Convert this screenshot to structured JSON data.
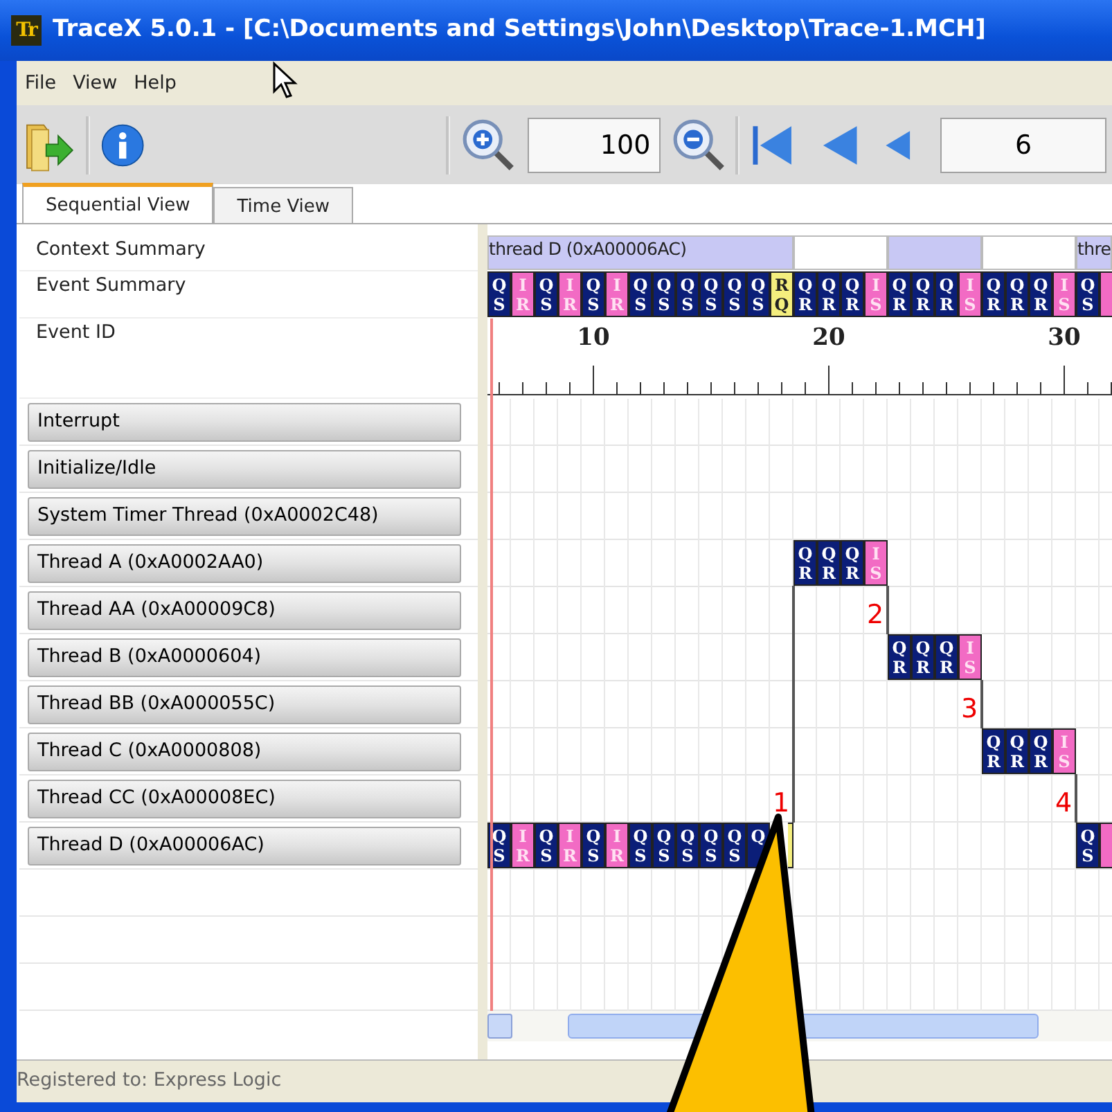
{
  "window": {
    "logo": "Tr",
    "title": "TraceX 5.0.1 - [C:\\Documents and Settings\\John\\Desktop\\Trace-1.MCH]"
  },
  "menu": [
    "File",
    "View",
    "Help"
  ],
  "toolbar": {
    "zoom_value": "100",
    "event_value": "6"
  },
  "tabs": [
    {
      "label": "Sequential View",
      "selected": true
    },
    {
      "label": "Time View",
      "selected": false
    }
  ],
  "summary_labels": [
    "Context Summary",
    "Event Summary",
    "Event ID"
  ],
  "context_segments": [
    {
      "label": "thread D (0xA00006AC)",
      "color": "#c8c8f4"
    },
    {
      "color": "#ffffff"
    },
    {
      "color": "#c8c8f4"
    },
    {
      "color": "#ffffff"
    },
    {
      "label": "thre",
      "color": "#c8c8f4"
    }
  ],
  "event_summary": [
    {
      "top": "Q",
      "bottom": "S",
      "color": "#0b1e78"
    },
    {
      "top": "I",
      "bottom": "R",
      "color": "#f26bc4"
    },
    {
      "top": "Q",
      "bottom": "S",
      "color": "#0b1e78"
    },
    {
      "top": "I",
      "bottom": "R",
      "color": "#f26bc4"
    },
    {
      "top": "Q",
      "bottom": "S",
      "color": "#0b1e78"
    },
    {
      "top": "I",
      "bottom": "R",
      "color": "#f26bc4"
    },
    {
      "top": "Q",
      "bottom": "S",
      "color": "#0b1e78"
    },
    {
      "top": "Q",
      "bottom": "S",
      "color": "#0b1e78"
    },
    {
      "top": "Q",
      "bottom": "S",
      "color": "#0b1e78"
    },
    {
      "top": "Q",
      "bottom": "S",
      "color": "#0b1e78"
    },
    {
      "top": "Q",
      "bottom": "S",
      "color": "#0b1e78"
    },
    {
      "top": "Q",
      "bottom": "S",
      "color": "#0b1e78"
    },
    {
      "top": "R",
      "bottom": "Q",
      "color": "#f4ee7e"
    },
    {
      "top": "Q",
      "bottom": "R",
      "color": "#0b1e78"
    },
    {
      "top": "Q",
      "bottom": "R",
      "color": "#0b1e78"
    },
    {
      "top": "Q",
      "bottom": "R",
      "color": "#0b1e78"
    },
    {
      "top": "I",
      "bottom": "S",
      "color": "#f26bc4"
    },
    {
      "top": "Q",
      "bottom": "R",
      "color": "#0b1e78"
    },
    {
      "top": "Q",
      "bottom": "R",
      "color": "#0b1e78"
    },
    {
      "top": "Q",
      "bottom": "R",
      "color": "#0b1e78"
    },
    {
      "top": "I",
      "bottom": "S",
      "color": "#f26bc4"
    },
    {
      "top": "Q",
      "bottom": "R",
      "color": "#0b1e78"
    },
    {
      "top": "Q",
      "bottom": "R",
      "color": "#0b1e78"
    },
    {
      "top": "Q",
      "bottom": "R",
      "color": "#0b1e78"
    },
    {
      "top": "I",
      "bottom": "S",
      "color": "#f26bc4"
    },
    {
      "top": "Q",
      "bottom": "S",
      "color": "#0b1e78"
    },
    {
      "color": "#f26bc4"
    }
  ],
  "ruler_ticks": [
    {
      "kind": "minor"
    },
    {
      "kind": "minor"
    },
    {
      "kind": "minor"
    },
    {
      "kind": "minor"
    },
    {
      "kind": "major",
      "label": "10"
    },
    {
      "kind": "minor"
    },
    {
      "kind": "minor"
    },
    {
      "kind": "minor"
    },
    {
      "kind": "minor"
    },
    {
      "kind": "minor"
    },
    {
      "kind": "minor"
    },
    {
      "kind": "minor"
    },
    {
      "kind": "minor"
    },
    {
      "kind": "minor"
    },
    {
      "kind": "major",
      "label": "20"
    },
    {
      "kind": "minor"
    },
    {
      "kind": "minor"
    },
    {
      "kind": "minor"
    },
    {
      "kind": "minor"
    },
    {
      "kind": "minor"
    },
    {
      "kind": "minor"
    },
    {
      "kind": "minor"
    },
    {
      "kind": "minor"
    },
    {
      "kind": "minor"
    },
    {
      "kind": "major",
      "label": "30"
    },
    {
      "kind": "minor"
    },
    {
      "kind": "minor"
    }
  ],
  "threads": [
    {
      "name": "Interrupt"
    },
    {
      "name": "Initialize/Idle"
    },
    {
      "name": "System Timer Thread (0xA0002C48)"
    },
    {
      "name": "Thread A (0xA0002AA0)",
      "cells": [
        {
          "kind": "empty"
        },
        {
          "kind": "empty"
        },
        {
          "kind": "empty"
        },
        {
          "kind": "empty"
        },
        {
          "kind": "empty"
        },
        {
          "kind": "empty"
        },
        {
          "kind": "empty"
        },
        {
          "kind": "empty"
        },
        {
          "kind": "empty"
        },
        {
          "kind": "empty"
        },
        {
          "kind": "empty"
        },
        {
          "kind": "empty"
        },
        {
          "kind": "empty"
        },
        {
          "kind": "event",
          "top": "Q",
          "bottom": "R",
          "color": "#0b1e78"
        },
        {
          "kind": "event",
          "top": "Q",
          "bottom": "R",
          "color": "#0b1e78"
        },
        {
          "kind": "event",
          "top": "Q",
          "bottom": "R",
          "color": "#0b1e78"
        },
        {
          "kind": "event",
          "top": "I",
          "bottom": "S",
          "color": "#f26bc4"
        },
        {
          "kind": "empty"
        },
        {
          "kind": "empty"
        },
        {
          "kind": "empty"
        },
        {
          "kind": "empty"
        },
        {
          "kind": "empty"
        },
        {
          "kind": "empty"
        },
        {
          "kind": "empty"
        },
        {
          "kind": "empty"
        },
        {
          "kind": "empty"
        },
        {
          "kind": "empty"
        }
      ]
    },
    {
      "name": "Thread AA (0xA00009C8)",
      "cells": [
        {
          "kind": "empty"
        },
        {
          "kind": "empty"
        },
        {
          "kind": "empty"
        },
        {
          "kind": "empty"
        },
        {
          "kind": "empty"
        },
        {
          "kind": "empty"
        },
        {
          "kind": "empty"
        },
        {
          "kind": "empty"
        },
        {
          "kind": "empty"
        },
        {
          "kind": "empty"
        },
        {
          "kind": "empty"
        },
        {
          "kind": "empty"
        },
        {
          "kind": "empty"
        },
        {
          "kind": "empty"
        },
        {
          "kind": "empty"
        },
        {
          "kind": "empty"
        },
        {
          "kind": "note",
          "note": "2"
        },
        {
          "kind": "empty"
        },
        {
          "kind": "empty"
        },
        {
          "kind": "empty"
        },
        {
          "kind": "empty"
        },
        {
          "kind": "empty"
        },
        {
          "kind": "empty"
        },
        {
          "kind": "empty"
        },
        {
          "kind": "empty"
        },
        {
          "kind": "empty"
        },
        {
          "kind": "empty"
        }
      ]
    },
    {
      "name": "Thread B (0xA0000604)",
      "cells": [
        {
          "kind": "empty"
        },
        {
          "kind": "empty"
        },
        {
          "kind": "empty"
        },
        {
          "kind": "empty"
        },
        {
          "kind": "empty"
        },
        {
          "kind": "empty"
        },
        {
          "kind": "empty"
        },
        {
          "kind": "empty"
        },
        {
          "kind": "empty"
        },
        {
          "kind": "empty"
        },
        {
          "kind": "empty"
        },
        {
          "kind": "empty"
        },
        {
          "kind": "empty"
        },
        {
          "kind": "empty"
        },
        {
          "kind": "empty"
        },
        {
          "kind": "empty"
        },
        {
          "kind": "empty"
        },
        {
          "kind": "event",
          "top": "Q",
          "bottom": "R",
          "color": "#0b1e78"
        },
        {
          "kind": "event",
          "top": "Q",
          "bottom": "R",
          "color": "#0b1e78"
        },
        {
          "kind": "event",
          "top": "Q",
          "bottom": "R",
          "color": "#0b1e78"
        },
        {
          "kind": "event",
          "top": "I",
          "bottom": "S",
          "color": "#f26bc4"
        },
        {
          "kind": "empty"
        },
        {
          "kind": "empty"
        },
        {
          "kind": "empty"
        },
        {
          "kind": "empty"
        },
        {
          "kind": "empty"
        },
        {
          "kind": "empty"
        }
      ]
    },
    {
      "name": "Thread BB (0xA000055C)",
      "cells": [
        {
          "kind": "empty"
        },
        {
          "kind": "empty"
        },
        {
          "kind": "empty"
        },
        {
          "kind": "empty"
        },
        {
          "kind": "empty"
        },
        {
          "kind": "empty"
        },
        {
          "kind": "empty"
        },
        {
          "kind": "empty"
        },
        {
          "kind": "empty"
        },
        {
          "kind": "empty"
        },
        {
          "kind": "empty"
        },
        {
          "kind": "empty"
        },
        {
          "kind": "empty"
        },
        {
          "kind": "empty"
        },
        {
          "kind": "empty"
        },
        {
          "kind": "empty"
        },
        {
          "kind": "empty"
        },
        {
          "kind": "empty"
        },
        {
          "kind": "empty"
        },
        {
          "kind": "empty"
        },
        {
          "kind": "note",
          "note": "3"
        },
        {
          "kind": "empty"
        },
        {
          "kind": "empty"
        },
        {
          "kind": "empty"
        },
        {
          "kind": "empty"
        },
        {
          "kind": "empty"
        },
        {
          "kind": "empty"
        }
      ]
    },
    {
      "name": "Thread C (0xA0000808)",
      "cells": [
        {
          "kind": "empty"
        },
        {
          "kind": "empty"
        },
        {
          "kind": "empty"
        },
        {
          "kind": "empty"
        },
        {
          "kind": "empty"
        },
        {
          "kind": "empty"
        },
        {
          "kind": "empty"
        },
        {
          "kind": "empty"
        },
        {
          "kind": "empty"
        },
        {
          "kind": "empty"
        },
        {
          "kind": "empty"
        },
        {
          "kind": "empty"
        },
        {
          "kind": "empty"
        },
        {
          "kind": "empty"
        },
        {
          "kind": "empty"
        },
        {
          "kind": "empty"
        },
        {
          "kind": "empty"
        },
        {
          "kind": "empty"
        },
        {
          "kind": "empty"
        },
        {
          "kind": "empty"
        },
        {
          "kind": "empty"
        },
        {
          "kind": "event",
          "top": "Q",
          "bottom": "R",
          "color": "#0b1e78"
        },
        {
          "kind": "event",
          "top": "Q",
          "bottom": "R",
          "color": "#0b1e78"
        },
        {
          "kind": "event",
          "top": "Q",
          "bottom": "R",
          "color": "#0b1e78"
        },
        {
          "kind": "event",
          "top": "I",
          "bottom": "S",
          "color": "#f26bc4"
        },
        {
          "kind": "empty"
        },
        {
          "kind": "empty"
        }
      ]
    },
    {
      "name": "Thread CC (0xA00008EC)",
      "cells": [
        {
          "kind": "empty"
        },
        {
          "kind": "empty"
        },
        {
          "kind": "empty"
        },
        {
          "kind": "empty"
        },
        {
          "kind": "empty"
        },
        {
          "kind": "empty"
        },
        {
          "kind": "empty"
        },
        {
          "kind": "empty"
        },
        {
          "kind": "empty"
        },
        {
          "kind": "empty"
        },
        {
          "kind": "empty"
        },
        {
          "kind": "empty"
        },
        {
          "kind": "note",
          "note": "1"
        },
        {
          "kind": "empty"
        },
        {
          "kind": "empty"
        },
        {
          "kind": "empty"
        },
        {
          "kind": "empty"
        },
        {
          "kind": "empty"
        },
        {
          "kind": "empty"
        },
        {
          "kind": "empty"
        },
        {
          "kind": "empty"
        },
        {
          "kind": "empty"
        },
        {
          "kind": "empty"
        },
        {
          "kind": "empty"
        },
        {
          "kind": "note",
          "note": "4"
        },
        {
          "kind": "empty"
        },
        {
          "kind": "empty"
        }
      ]
    },
    {
      "name": "Thread D (0xA00006AC)",
      "cells": [
        {
          "kind": "event",
          "top": "Q",
          "bottom": "S",
          "color": "#0b1e78"
        },
        {
          "kind": "event",
          "top": "I",
          "bottom": "R",
          "color": "#f26bc4"
        },
        {
          "kind": "event",
          "top": "Q",
          "bottom": "S",
          "color": "#0b1e78"
        },
        {
          "kind": "event",
          "top": "I",
          "bottom": "R",
          "color": "#f26bc4"
        },
        {
          "kind": "event",
          "top": "Q",
          "bottom": "S",
          "color": "#0b1e78"
        },
        {
          "kind": "event",
          "top": "I",
          "bottom": "R",
          "color": "#f26bc4"
        },
        {
          "kind": "event",
          "top": "Q",
          "bottom": "S",
          "color": "#0b1e78"
        },
        {
          "kind": "event",
          "top": "Q",
          "bottom": "S",
          "color": "#0b1e78"
        },
        {
          "kind": "event",
          "top": "Q",
          "bottom": "S",
          "color": "#0b1e78"
        },
        {
          "kind": "event",
          "top": "Q",
          "bottom": "S",
          "color": "#0b1e78"
        },
        {
          "kind": "event",
          "top": "Q",
          "bottom": "S",
          "color": "#0b1e78"
        },
        {
          "kind": "event",
          "top": "Q",
          "color": "#0b1e78"
        },
        {
          "kind": "sliver",
          "color": "#f4ee7e"
        },
        {
          "kind": "empty"
        },
        {
          "kind": "empty"
        },
        {
          "kind": "empty"
        },
        {
          "kind": "empty"
        },
        {
          "kind": "empty"
        },
        {
          "kind": "empty"
        },
        {
          "kind": "empty"
        },
        {
          "kind": "empty"
        },
        {
          "kind": "empty"
        },
        {
          "kind": "empty"
        },
        {
          "kind": "empty"
        },
        {
          "kind": "empty"
        },
        {
          "kind": "event",
          "top": "Q",
          "bottom": "S",
          "color": "#0b1e78"
        },
        {
          "kind": "event",
          "color": "#f26bc4"
        }
      ]
    }
  ],
  "status_bar": "Registered to: Express Logic"
}
